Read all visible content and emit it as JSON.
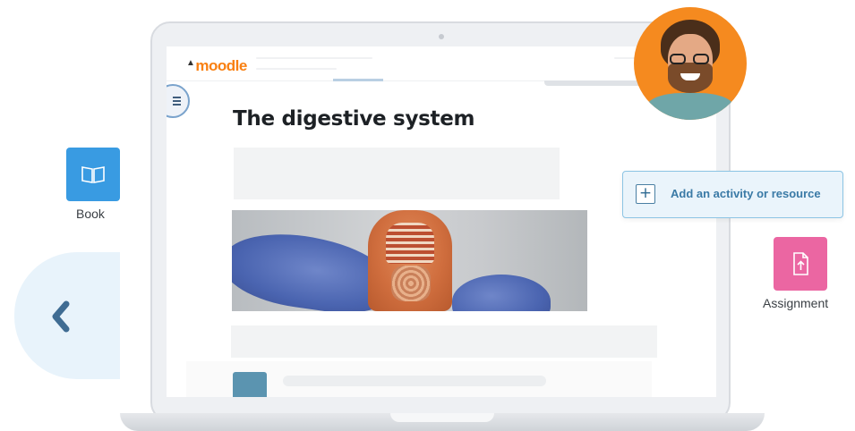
{
  "screen": {
    "brand": "moodle",
    "page_title": "The digestive system"
  },
  "floating": {
    "book_label": "Book",
    "assignment_label": "Assignment",
    "add_activity_label": "Add an activity or resource",
    "add_activity_symbol": "+"
  },
  "icons": {
    "book": "book-open-icon",
    "assignment": "file-upload-icon",
    "back": "chevron-left-icon",
    "drawer": "list-icon"
  },
  "colors": {
    "brand_orange": "#f98012",
    "book_tile": "#399be2",
    "assignment_tile": "#eb66a2",
    "accent_blue": "#3a7aa6",
    "avatar_bg": "#f58a1f"
  }
}
